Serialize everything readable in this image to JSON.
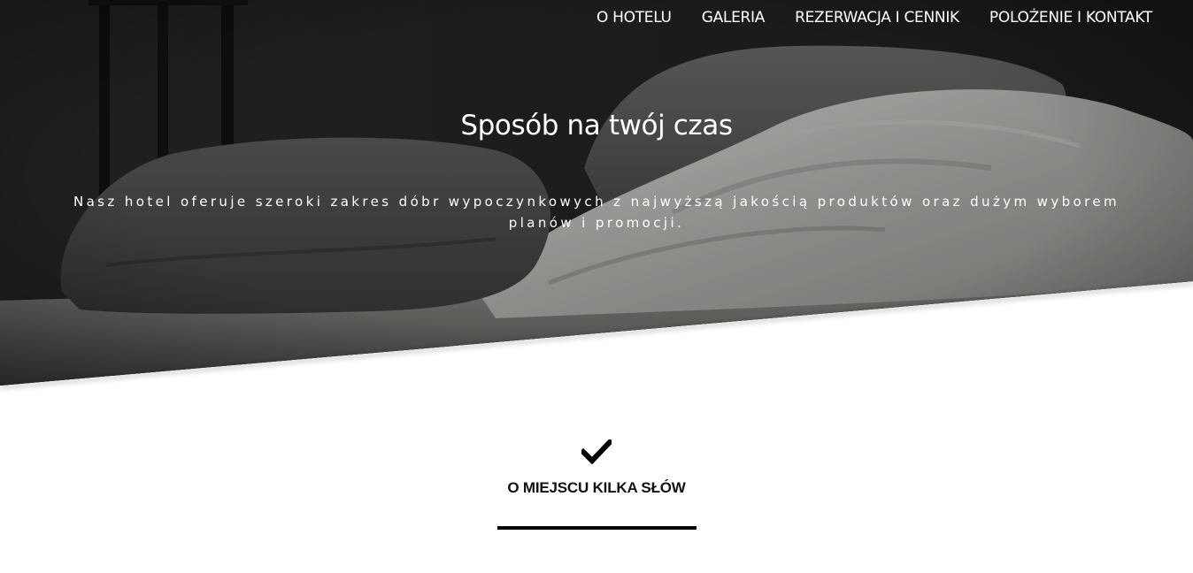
{
  "nav": {
    "items": [
      {
        "label": "O HOTELU"
      },
      {
        "label": "GALERIA"
      },
      {
        "label": "REZERWACJA I CENNIK"
      },
      {
        "label": "POLOŻENIE I KONTAKT"
      }
    ]
  },
  "hero": {
    "title": "Sposób na twój czas",
    "subtitle": "Nasz hotel oferuje szeroki zakres dóbr wypoczynkowych z najwyższą jakością produktów oraz dużym wyborem planów i promocji.",
    "image": "dark bedroom photo with pillows and duvet"
  },
  "section": {
    "icon": "check-icon",
    "title": "O MIEJSCU KILKA SŁÓW"
  }
}
